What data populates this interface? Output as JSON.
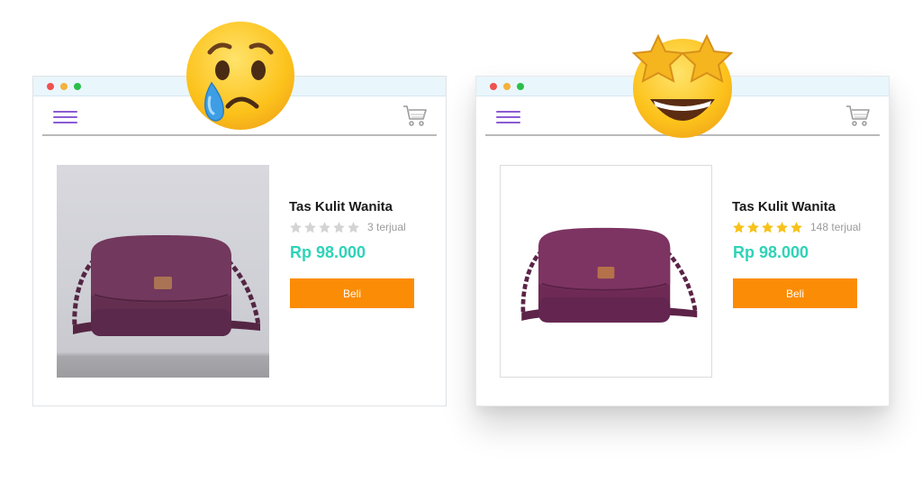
{
  "panels": [
    {
      "id": "before",
      "emoji": "crying-face-emoji",
      "product": {
        "title": "Tas Kulit Wanita",
        "rating_stars": 0,
        "rating_max": 5,
        "sold": "3 terjual",
        "price": "Rp 98.000",
        "buy_label": "Beli"
      }
    },
    {
      "id": "after",
      "emoji": "star-struck-emoji",
      "product": {
        "title": "Tas Kulit Wanita",
        "rating_stars": 5,
        "rating_max": 5,
        "sold": "148 terjual",
        "price": "Rp 98.000",
        "buy_label": "Beli"
      }
    }
  ],
  "colors": {
    "titlebar": "#e9f6fc",
    "menu": "#8a5bd3",
    "price": "#2fd3b7",
    "buy_button": "#fb8c05",
    "star_filled": "#f7c21a",
    "star_empty": "#d4d4d4",
    "bag": "#6e2a55"
  }
}
